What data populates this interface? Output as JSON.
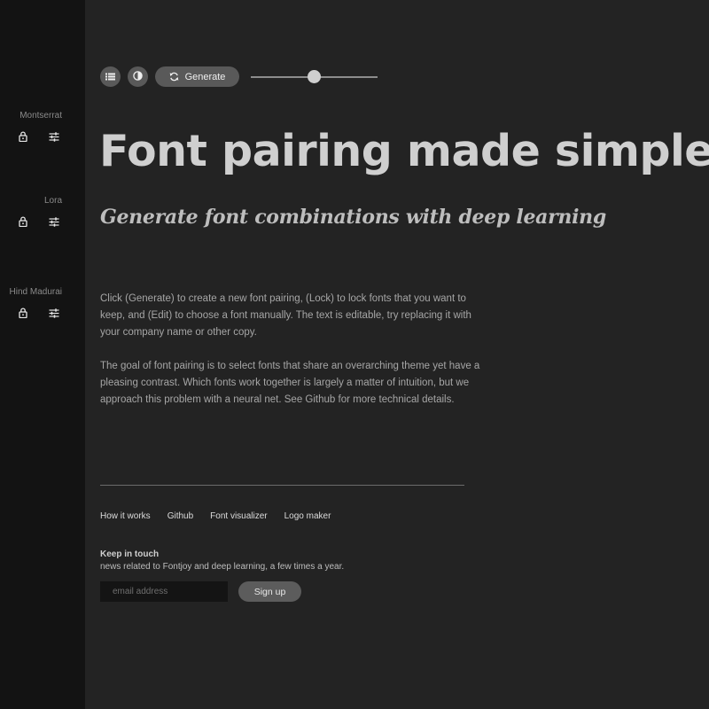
{
  "sidebar": {
    "fonts": [
      {
        "name": "Montserrat"
      },
      {
        "name": "Lora"
      },
      {
        "name": "Hind Madurai"
      }
    ]
  },
  "toolbar": {
    "generate_label": "Generate",
    "slider_value": 0.5
  },
  "content": {
    "headline": "Font pairing made simple",
    "subhead": "Generate font combinations with deep learning",
    "paragraphs": [
      "Click (Generate) to create a new font pairing, (Lock) to lock fonts that you want to keep, and (Edit) to choose a font manually. The text is editable, try replacing it with your company name or other copy.",
      "The goal of font pairing is to select fonts that share an overarching theme yet have a pleasing contrast. Which fonts work together is largely a matter of intuition, but we approach this problem with a neural net. See Github for more technical details."
    ]
  },
  "footer": {
    "links": [
      "How it works",
      "Github",
      "Font visualizer",
      "Logo maker"
    ],
    "keep_in_touch_title": "Keep in touch",
    "keep_in_touch_desc": "news related to Fontjoy and deep learning, a few times a year.",
    "email_placeholder": "email address",
    "signup_label": "Sign up"
  },
  "icons": {
    "list": "list-icon",
    "contrast": "contrast-icon",
    "refresh": "refresh-icon",
    "lock": "lock-icon",
    "tune": "sliders-icon"
  },
  "colors": {
    "background": "#232323",
    "sidebar": "#131313",
    "button": "#595959",
    "headline": "#cfcfcf"
  }
}
